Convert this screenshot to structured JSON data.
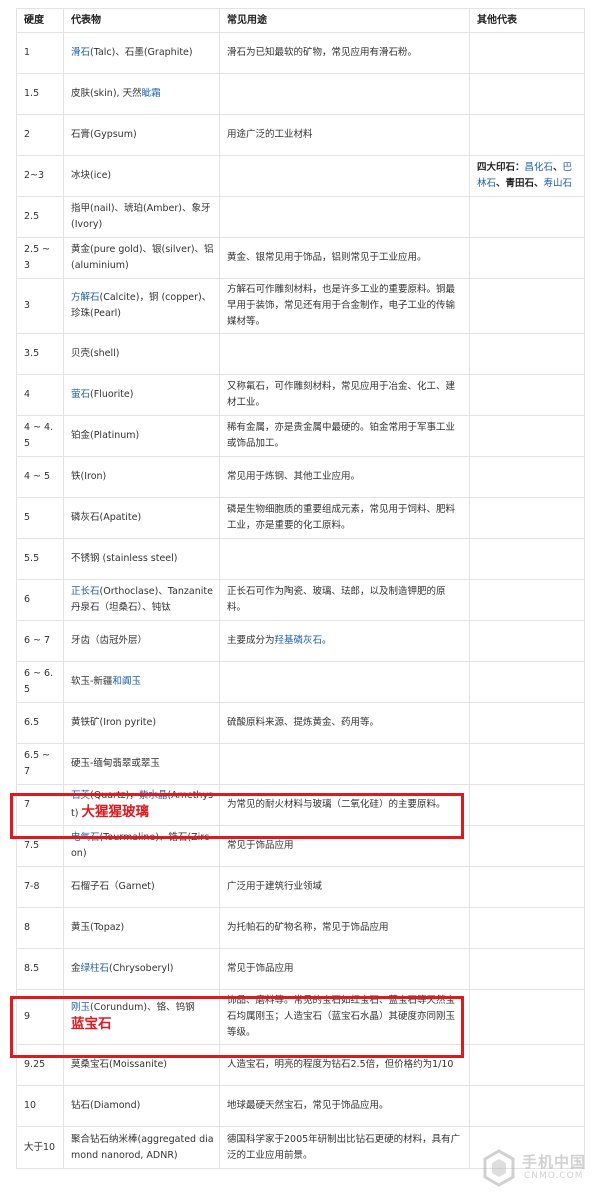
{
  "headers": [
    "硬度",
    "代表物",
    "常见用途",
    "其他代表"
  ],
  "rows": [
    {
      "hardness": "1",
      "rep": [
        {
          "t": "滑石",
          "link": true
        },
        {
          "t": "(Talc)、石墨(Graphite)"
        }
      ],
      "use": "滑石为已知最软的矿物，常见应用有滑石粉。",
      "other": []
    },
    {
      "hardness": "1.5",
      "rep": [
        {
          "t": "皮肤(skin), 天然"
        },
        {
          "t": "眦霜",
          "link": true
        }
      ],
      "use": "",
      "other": []
    },
    {
      "hardness": "2",
      "rep": [
        {
          "t": "石膏(Gypsum)"
        }
      ],
      "use": "用途广泛的工业材料",
      "other": []
    },
    {
      "hardness": "2~3",
      "rep": [
        {
          "t": "冰块(ice)"
        }
      ],
      "use": "",
      "other": [
        {
          "t": "四大印石：",
          "bold": true
        },
        {
          "t": "昌化石",
          "link": true
        },
        {
          "t": "、",
          "bold": true
        },
        {
          "t": "巴林石",
          "link": true
        },
        {
          "t": "、青田石、",
          "bold": true
        },
        {
          "t": "寿山石",
          "link": true
        }
      ]
    },
    {
      "hardness": "2.5",
      "rep": [
        {
          "t": "指甲(nail)、琥珀(Amber)、象牙(Ivory)"
        }
      ],
      "use": "",
      "other": []
    },
    {
      "hardness": "2.5 ~ 3",
      "rep": [
        {
          "t": "黄金(pure gold)、银(silver)、铝 (aluminium)"
        }
      ],
      "use": "黄金、银常见用于饰品，铝则常见于工业应用。",
      "other": []
    },
    {
      "hardness": "3",
      "rep": [
        {
          "t": "方解石",
          "link": true
        },
        {
          "t": "(Calcite)，铜 (copper)、珍珠(Pearl)"
        }
      ],
      "use": "方解石可作雕刻材料，也是许多工业的重要原料。铜最早用于装饰，常见还有用于合金制作，电子工业的传输媒材等。",
      "other": []
    },
    {
      "hardness": "3.5",
      "rep": [
        {
          "t": "贝壳(shell)"
        }
      ],
      "use": "",
      "other": []
    },
    {
      "hardness": "4",
      "rep": [
        {
          "t": "萤石",
          "link": true
        },
        {
          "t": "(Fluorite)"
        }
      ],
      "use": "又称氟石，可作雕刻材料，常见应用于冶金、化工、建材工业。",
      "other": []
    },
    {
      "hardness": "4 ~ 4.5",
      "rep": [
        {
          "t": "铂金(Platinum)"
        }
      ],
      "use": "稀有金属，亦是贵金属中最硬的。铂金常用于军事工业或饰品加工。",
      "other": []
    },
    {
      "hardness": "4 ~ 5",
      "rep": [
        {
          "t": "铁(Iron)"
        }
      ],
      "use": "常见用于炼钢、其他工业应用。",
      "other": []
    },
    {
      "hardness": "5",
      "rep": [
        {
          "t": "磷灰石(Apatite)"
        }
      ],
      "use": "磷是生物细胞质的重要组成元素，常见用于饲料、肥料工业，亦是重要的化工原料。",
      "other": []
    },
    {
      "hardness": "5.5",
      "rep": [
        {
          "t": "不锈钢 (stainless steel)"
        }
      ],
      "use": "",
      "other": []
    },
    {
      "hardness": "6",
      "rep": [
        {
          "t": "正长石",
          "link": true
        },
        {
          "t": "(Orthoclase)、Tanzanite 丹泉石（坦桑石）、钝钛"
        }
      ],
      "use": "正长石可作为陶瓷、玻璃、珐郎，以及制造钾肥的原料。",
      "other": []
    },
    {
      "hardness": "6 ~ 7",
      "rep": [
        {
          "t": "牙齿（齿冠外层）"
        }
      ],
      "use": "主要成分为",
      "use_link": "羟基磷灰石",
      "use_tail": "。",
      "other": []
    },
    {
      "hardness": "6 ~ 6.5",
      "rep": [
        {
          "t": "软玉-新疆"
        },
        {
          "t": "和阗玉",
          "link": true
        }
      ],
      "use": "",
      "other": []
    },
    {
      "hardness": "6.5",
      "rep": [
        {
          "t": "黄铁矿(Iron pyrite)"
        }
      ],
      "use": "硫酸原料来源、提炼黄金、药用等。",
      "other": []
    },
    {
      "hardness": "6.5 ~ 7",
      "rep": [
        {
          "t": "硬玉-缅甸翡翠或翠玉"
        }
      ],
      "use": "",
      "other": []
    },
    {
      "hardness": "7",
      "rep": [
        {
          "t": "石英",
          "link": true
        },
        {
          "t": "(Quartz)，"
        },
        {
          "t": "紫水晶",
          "link": true
        },
        {
          "t": "(Amethyst)"
        }
      ],
      "label": "大猩猩玻璃",
      "use": "为常见的耐火材料与玻璃（二氧化硅）的主要原料。",
      "other": []
    },
    {
      "hardness": "7.5",
      "rep": [
        {
          "t": "电气石",
          "link": true
        },
        {
          "t": "(Tourmaline)、锆石(Zircon)"
        }
      ],
      "use": "常见于饰品应用",
      "other": []
    },
    {
      "hardness": "7-8",
      "rep": [
        {
          "t": "石榴子石（Garnet)"
        }
      ],
      "use": "广泛用于建筑行业领域",
      "other": []
    },
    {
      "hardness": "8",
      "rep": [
        {
          "t": "黄玉(Topaz)"
        }
      ],
      "use": "为托帕石的矿物名称，常见于饰品应用",
      "other": []
    },
    {
      "hardness": "8.5",
      "rep": [
        {
          "t": "金"
        },
        {
          "t": "绿柱石",
          "link": true
        },
        {
          "t": "(Chrysoberyl)"
        }
      ],
      "use": "常见于饰品应用",
      "other": []
    },
    {
      "hardness": "9",
      "rep": [
        {
          "t": "刚玉",
          "link": true
        },
        {
          "t": "(Corundum)、铬、钨钢"
        }
      ],
      "label": "蓝宝石",
      "use": "饰品、磨料等。常见的宝石如红宝石、蓝宝石等天然宝石均属刚玉；人造宝石（蓝宝石水晶）其硬度亦同刚玉等级。",
      "other": []
    },
    {
      "hardness": "9.25",
      "rep": [
        {
          "t": "莫桑宝石(Moissanite)"
        }
      ],
      "use": "人造宝石，明亮的程度为钻石2.5倍，但价格约为1/10",
      "other": []
    },
    {
      "hardness": "10",
      "rep": [
        {
          "t": "钻石(Diamond)"
        }
      ],
      "use": "地球最硬天然宝石，常见于饰品应用。",
      "other": []
    },
    {
      "hardness": "大于10",
      "rep": [
        {
          "t": "聚合钻石纳米棒(aggregated diamond nanorod, ADNR)"
        }
      ],
      "use": "德国科学家于2005年研制出比钻石更硬的材料，具有广泛的工业应用前景。",
      "other": []
    }
  ],
  "watermark": {
    "title": "手机中国",
    "sub": "CNMO.COM"
  },
  "colors": {
    "link": "#1f5fad",
    "highlight": "#e0191f",
    "border": "#e3e3e3",
    "text": "#333333"
  }
}
